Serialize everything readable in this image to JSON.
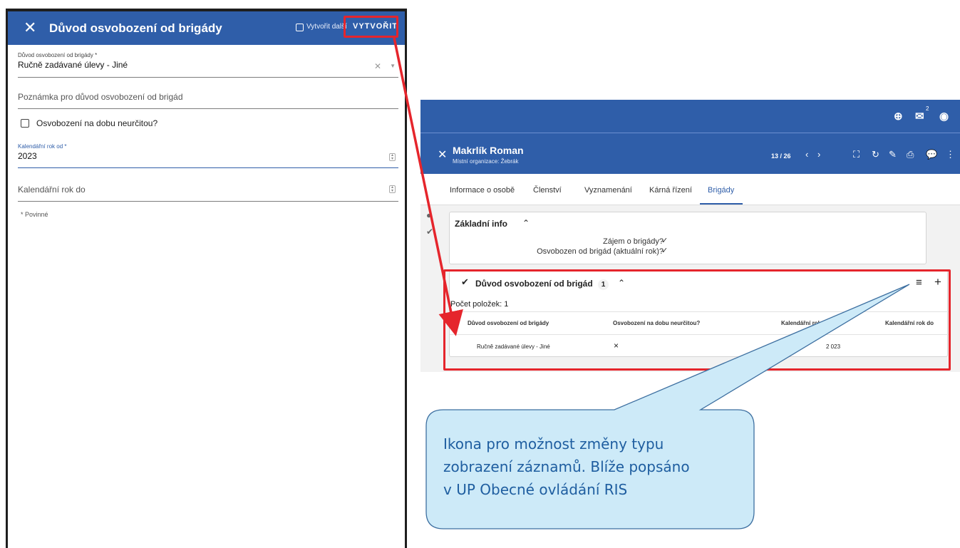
{
  "dialog": {
    "close_icon": "close-icon",
    "title": "Důvod osvobození od brigády",
    "create_another_label": "Vytvořit další",
    "create_button": "VYTVOŘIT",
    "reason_label": "Důvod osvobození od brigády *",
    "reason_value": "Ručně zadávané úlevy - Jiné",
    "note_placeholder": "Poznámka pro důvod osvobození od brigád",
    "indefinite_label": "Osvobození na dobu neurčitou?",
    "year_from_label": "Kalendářní rok od *",
    "year_from_value": "2023",
    "year_to_placeholder": "Kalendářní rok do",
    "required_note": "* Povinné"
  },
  "app": {
    "topbar": {
      "mail_count": "2"
    },
    "record": {
      "name": "Makrlík Roman",
      "subtitle": "Místní organizace: Žebrák",
      "pager": "13 / 26"
    },
    "tabs": [
      "Informace o osobě",
      "Členství",
      "Vyznamenání",
      "Kárná řízení",
      "Brigády"
    ],
    "active_tab": "Brigády",
    "basic_info": {
      "title": "Základní info",
      "interest_label": "Zájem o brigády?",
      "interest_value": "✓",
      "exempt_label": "Osvobozen od brigád (aktuální rok)?",
      "exempt_value": "✓"
    },
    "exemption_section": {
      "title": "Důvod osvobození od brigád",
      "count_badge": "1",
      "items_count": "Počet položek: 1",
      "columns": [
        "Důvod osvobození od brigády",
        "Osvobození na dobu neurčitou?",
        "Kalendářní rok od",
        "Kalendářní rok do"
      ],
      "rows": [
        {
          "reason": "Ručně zadávané úlevy - Jiné",
          "indefinite": "×",
          "year_from": "2 023",
          "year_to": ""
        }
      ]
    }
  },
  "callout": {
    "line1": "Ikona pro možnost změny typu",
    "line2": "zobrazení záznamů. Blíže popsáno",
    "line3": "v UP Obecné ovládání RIS"
  },
  "colors": {
    "primary": "#2f5ea9",
    "annotation_red": "#e5252c",
    "callout_fill": "#cdeaf8",
    "callout_stroke": "#3d6fa0"
  }
}
